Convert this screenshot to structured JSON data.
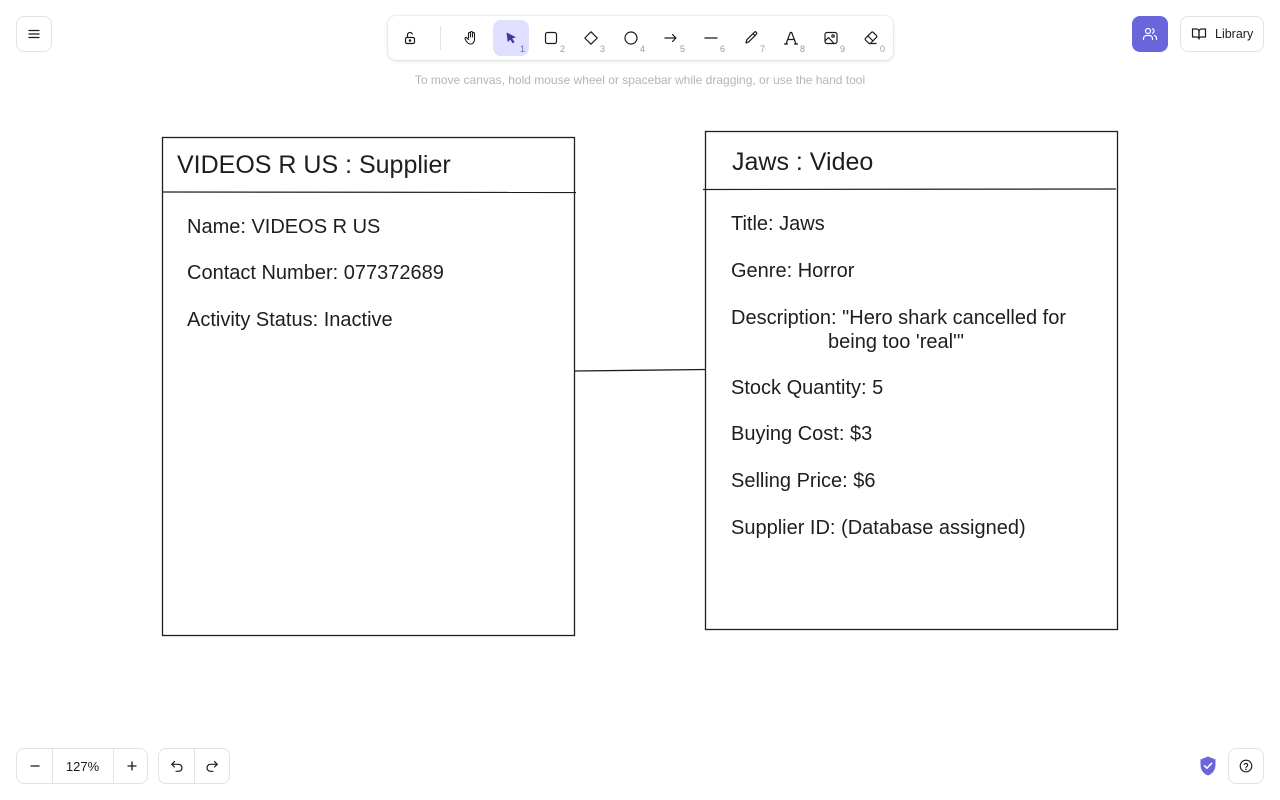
{
  "toolbar": {
    "tools": [
      {
        "name": "lock",
        "key": ""
      },
      {
        "name": "hand",
        "key": ""
      },
      {
        "name": "selection",
        "key": "1"
      },
      {
        "name": "rectangle",
        "key": "2"
      },
      {
        "name": "diamond",
        "key": "3"
      },
      {
        "name": "ellipse",
        "key": "4"
      },
      {
        "name": "arrow",
        "key": "5"
      },
      {
        "name": "line",
        "key": "6"
      },
      {
        "name": "draw",
        "key": "7"
      },
      {
        "name": "text",
        "key": "8"
      },
      {
        "name": "image",
        "key": "9"
      },
      {
        "name": "eraser",
        "key": "0"
      }
    ],
    "selected_tool": "selection"
  },
  "hint": "To move canvas, hold mouse wheel or spacebar while dragging, or use the hand tool",
  "top_right": {
    "library_label": "Library"
  },
  "canvas": {
    "supplier_box": {
      "title": "VIDEOS R US : Supplier",
      "fields": [
        "Name: VIDEOS R US",
        "Contact Number: 077372689",
        "Activity Status: Inactive"
      ]
    },
    "video_box": {
      "title": "Jaws : Video",
      "title_field": "Title: Jaws",
      "genre_field": "Genre: Horror",
      "description_line1": "Description: \"Hero shark cancelled for",
      "description_line2": "being too 'real'\"",
      "stock_field": "Stock Quantity: 5",
      "buying_field": "Buying Cost: $3",
      "selling_field": "Selling Price: $6",
      "supplier_field": "Supplier ID: (Database assigned)"
    }
  },
  "bottom": {
    "zoom_level": "127%"
  },
  "colors": {
    "accent": "#6965db",
    "accent_light": "#e0dfff",
    "stroke": "#1e1e1e"
  }
}
